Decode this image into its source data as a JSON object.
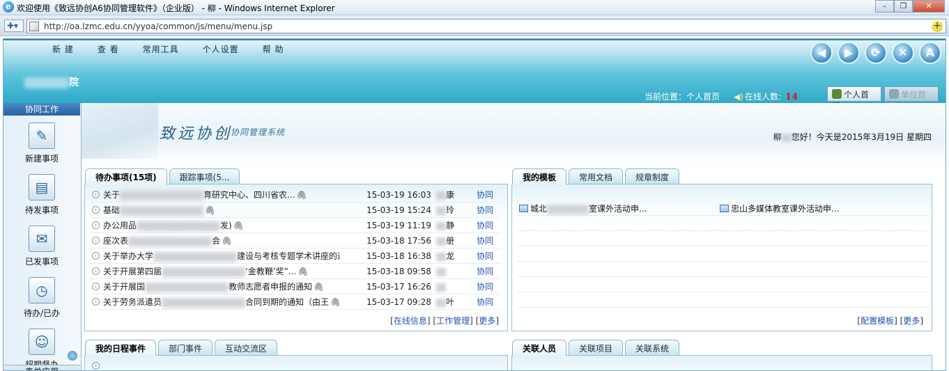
{
  "window": {
    "title": "欢迎使用《致远协创A6协同管理软件》（企业版） - 柳   ",
    "title_suffix": "- Windows Internet Explorer",
    "buttons": [
      "–",
      "❐",
      "✕"
    ]
  },
  "address": {
    "url": "http://oa.lzmc.edu.cn/yyoa/common/js/menu/menu.jsp"
  },
  "header": {
    "menu": [
      "新  建",
      "查  看",
      "常用工具",
      "个人设置",
      "帮  助"
    ],
    "org_suffix": "院",
    "location_label": "当前位置：个人首页",
    "online_label": "在线人数:",
    "online_count": "14",
    "personal_home": "个人首页",
    "unit_home": "单位首页",
    "icons": [
      "back-icon",
      "forward-icon",
      "refresh-icon",
      "close-icon",
      "font-size-icon"
    ]
  },
  "sidebar": {
    "header": "协同工作",
    "items": [
      {
        "label": "新建事项",
        "icon": "new-item-icon"
      },
      {
        "label": "待发事项",
        "icon": "pending-send-icon"
      },
      {
        "label": "已发事项",
        "icon": "sent-item-icon"
      },
      {
        "label": "待办/已办",
        "icon": "todo-done-icon"
      },
      {
        "label": "超期督办",
        "icon": "overdue-supervise-icon"
      }
    ],
    "bottom": "表单应用"
  },
  "banner": {
    "brand": "致远协创",
    "brand_sub": "协同管理系统",
    "greeting_prefix": "柳",
    "greeting": "您好！今天是2015年3月19日 星期四"
  },
  "todo_panel": {
    "tabs": [
      "待办事项(15项)",
      "跟踪事项(5..."
    ],
    "rows": [
      {
        "title_a": "关于",
        "title_b": "育研究中心、四川省农...",
        "clip": true,
        "date": "15-03-19 16:03",
        "sender": "康",
        "category": "协同"
      },
      {
        "title_a": "基础",
        "title_b": "",
        "clip": true,
        "date": "15-03-19 15:24",
        "sender": "玲",
        "category": "协同"
      },
      {
        "title_a": "办公用品",
        "title_b": "发)",
        "clip": true,
        "date": "15-03-19 11:19",
        "sender": "静",
        "category": "协同"
      },
      {
        "title_a": "座次表",
        "title_b": "会",
        "clip": true,
        "date": "15-03-18 17:56",
        "sender": "册",
        "category": "协同"
      },
      {
        "title_a": "关于举办大学",
        "title_b": "建设与考核专题学术讲座的通知",
        "clip": true,
        "date": "15-03-18 16:38",
        "sender": "龙",
        "category": "协同"
      },
      {
        "title_a": "关于开展第四届",
        "title_b": "‘金教鞭’奖”...",
        "clip": true,
        "date": "15-03-18 09:58",
        "sender": "",
        "category": "协同"
      },
      {
        "title_a": "关于开展国",
        "title_b": "教师志愿者申报的通知",
        "clip": true,
        "date": "15-03-17 16:26",
        "sender": "",
        "category": "协同"
      },
      {
        "title_a": "关于劳务派遣员",
        "title_b": "合同到期的通知（由王",
        "clip": true,
        "date": "15-03-17 09:28",
        "sender": "叶",
        "category": "协同"
      }
    ],
    "links": [
      "在线信息",
      "工作管理",
      "更多"
    ]
  },
  "template_panel": {
    "tabs": [
      "我的模板",
      "常用文档",
      "规章制度"
    ],
    "items": [
      {
        "prefix": "城北",
        "suffix": "室课外活动申..."
      },
      {
        "prefix": "",
        "suffix": "忠山多媒体教室课外活动申..."
      }
    ],
    "links": [
      "配置模板",
      "更多"
    ]
  },
  "schedule_panel": {
    "tabs": [
      "我的日程事件",
      "部门事件",
      "互动交流区"
    ]
  },
  "related_panel": {
    "tabs": [
      "关联人员",
      "关联项目",
      "关联系统"
    ]
  }
}
